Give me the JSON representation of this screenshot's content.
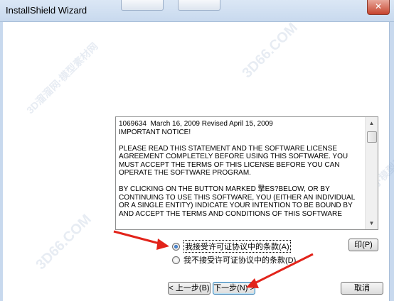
{
  "window": {
    "title": "InstallShield Wizard",
    "close_glyph": "✕"
  },
  "license": {
    "lines": [
      "1069634  March 16, 2009 Revised April 15, 2009",
      "IMPORTANT NOTICE!",
      "",
      "PLEASE READ THIS STATEMENT AND THE SOFTWARE LICENSE",
      "AGREEMENT COMPLETELY BEFORE USING THIS SOFTWARE. YOU",
      "MUST ACCEPT THE TERMS OF THIS LICENSE BEFORE YOU CAN",
      "OPERATE THE SOFTWARE PROGRAM.",
      "",
      "BY CLICKING ON THE BUTTON MARKED 撃ES?BELOW, OR BY",
      "CONTINUING TO USE THIS SOFTWARE, YOU (EITHER AN INDIVIDUAL",
      "OR A SINGLE ENTITY) INDICATE YOUR INTENTION TO BE BOUND BY",
      "AND ACCEPT THE TERMS AND CONDITIONS OF THIS SOFTWARE"
    ],
    "scroll_up_glyph": "▲",
    "scroll_down_glyph": "▼"
  },
  "options": {
    "accept_label": "我接受许可证协议中的条款(A)",
    "decline_label": "我不接受许可证协议中的条款(D)",
    "selected": "accept"
  },
  "buttons": {
    "print": "印(P)",
    "back": "< 上一步(B)",
    "next": "下一步(N) >",
    "cancel": "取消"
  },
  "watermarks": {
    "site": "3D66.COM",
    "cn": "3D溜溜网·模型素材网"
  }
}
